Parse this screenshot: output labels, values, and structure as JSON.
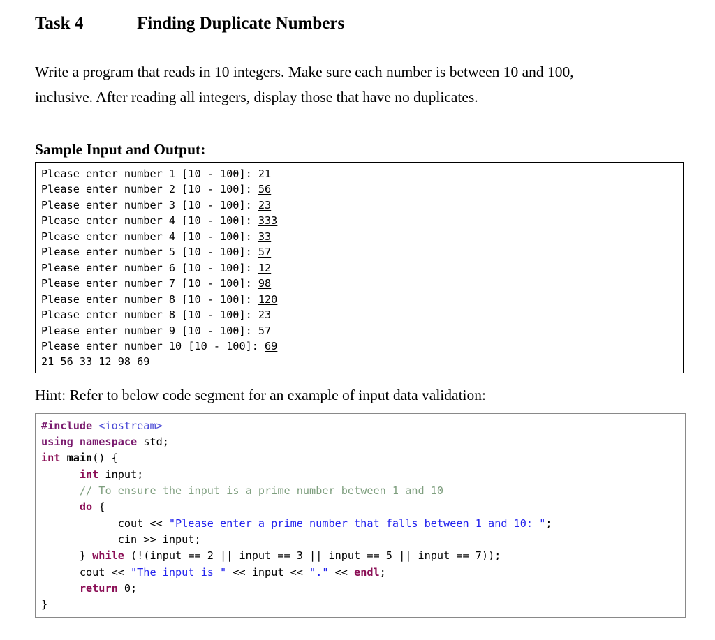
{
  "document": {
    "title_label": "Task 4",
    "title_name": "Finding Duplicate Numbers",
    "paragraph_line1": "Write a program that reads in 10 integers. Make sure each number is between 10 and 100,",
    "paragraph_line2": "inclusive. After reading all integers, display those that have no duplicates.",
    "sample_heading": "Sample Input and Output:",
    "hint_text": "Hint: Refer to below code segment for an example of input data validation:"
  },
  "console": {
    "lines": [
      {
        "prompt": "Please enter number 1 [10 - 100]: ",
        "typed": "21"
      },
      {
        "prompt": "Please enter number 2 [10 - 100]: ",
        "typed": "56"
      },
      {
        "prompt": "Please enter number 3 [10 - 100]: ",
        "typed": "23"
      },
      {
        "prompt": "Please enter number 4 [10 - 100]: ",
        "typed": "333"
      },
      {
        "prompt": "Please enter number 4 [10 - 100]: ",
        "typed": "33"
      },
      {
        "prompt": "Please enter number 5 [10 - 100]: ",
        "typed": "57"
      },
      {
        "prompt": "Please enter number 6 [10 - 100]: ",
        "typed": "12"
      },
      {
        "prompt": "Please enter number 7 [10 - 100]: ",
        "typed": "98"
      },
      {
        "prompt": "Please enter number 8 [10 - 100]: ",
        "typed": "120"
      },
      {
        "prompt": "Please enter number 8 [10 - 100]: ",
        "typed": "23"
      },
      {
        "prompt": "Please enter number 9 [10 - 100]: ",
        "typed": "57"
      },
      {
        "prompt": "Please enter number 10 [10 - 100]: ",
        "typed": "69"
      }
    ],
    "result_line": "21 56 33 12 98 69"
  },
  "code": {
    "language": "cpp",
    "lines": [
      [
        {
          "t": "#include ",
          "c": "pre"
        },
        {
          "t": "<iostream>",
          "c": "hdr"
        }
      ],
      [
        {
          "t": "using namespace ",
          "c": "pre"
        },
        {
          "t": "std;",
          "c": "plain"
        }
      ],
      [
        {
          "t": "int ",
          "c": "kw"
        },
        {
          "t": "main",
          "c": "fn"
        },
        {
          "t": "() {",
          "c": "plain"
        }
      ],
      [
        {
          "t": "      ",
          "c": "plain"
        },
        {
          "t": "int ",
          "c": "kw"
        },
        {
          "t": "input;",
          "c": "plain"
        }
      ],
      [
        {
          "t": "      ",
          "c": "plain"
        },
        {
          "t": "// To ensure the input is a prime number between 1 and 10",
          "c": "cmt"
        }
      ],
      [
        {
          "t": "      ",
          "c": "plain"
        },
        {
          "t": "do ",
          "c": "kw"
        },
        {
          "t": "{",
          "c": "plain"
        }
      ],
      [
        {
          "t": "            cout << ",
          "c": "plain"
        },
        {
          "t": "\"Please enter a prime number that falls between 1 and 10: \"",
          "c": "str"
        },
        {
          "t": ";",
          "c": "plain"
        }
      ],
      [
        {
          "t": "            cin >> input;",
          "c": "plain"
        }
      ],
      [
        {
          "t": "      } ",
          "c": "plain"
        },
        {
          "t": "while ",
          "c": "kw"
        },
        {
          "t": "(!(input == 2 || input == 3 || input == 5 || input == 7));",
          "c": "plain"
        }
      ],
      [
        {
          "t": "      cout << ",
          "c": "plain"
        },
        {
          "t": "\"The input is \"",
          "c": "str"
        },
        {
          "t": " << input << ",
          "c": "plain"
        },
        {
          "t": "\".\"",
          "c": "str"
        },
        {
          "t": " << ",
          "c": "plain"
        },
        {
          "t": "endl",
          "c": "kw"
        },
        {
          "t": ";",
          "c": "plain"
        }
      ],
      [
        {
          "t": "      ",
          "c": "plain"
        },
        {
          "t": "return ",
          "c": "kw"
        },
        {
          "t": "0;",
          "c": "plain"
        }
      ],
      [
        {
          "t": "}",
          "c": "plain"
        }
      ]
    ]
  },
  "colors": {
    "keyword": "#8b0f56",
    "preprocessor": "#7a1a6e",
    "header": "#4a4ad6",
    "string": "#2222ee",
    "comment": "#7f9f7f",
    "text": "#000000",
    "console_border": "#000000",
    "code_border": "#898989",
    "background": "#ffffff"
  }
}
